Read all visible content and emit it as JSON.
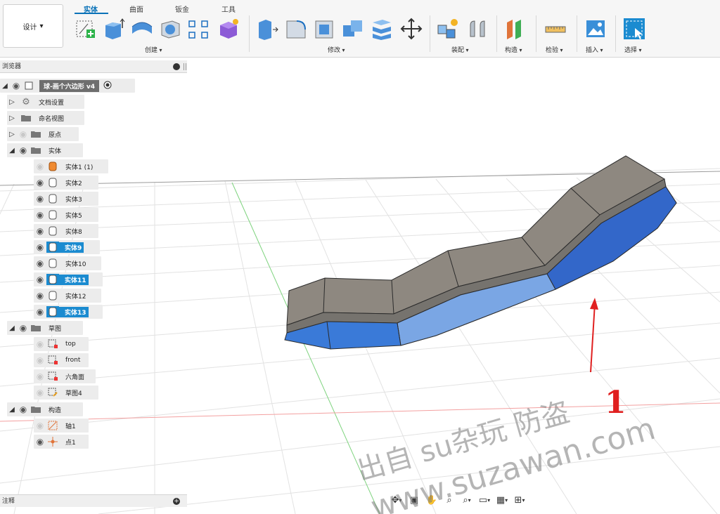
{
  "toolbar": {
    "workspace_label": "设计",
    "tabs": [
      "实体",
      "曲面",
      "钣金",
      "工具"
    ],
    "active_tab": "实体",
    "groups": [
      "创建",
      "修改",
      "装配",
      "构造",
      "检验",
      "插入",
      "选择"
    ]
  },
  "browser": {
    "title": "浏览器",
    "root_label": "球-画个六边形 v4",
    "items": [
      {
        "label": "文档设置"
      },
      {
        "label": "命名视图"
      },
      {
        "label": "原点"
      },
      {
        "label": "实体"
      },
      {
        "label": "实体1 (1)"
      },
      {
        "label": "实体2"
      },
      {
        "label": "实体3"
      },
      {
        "label": "实体5"
      },
      {
        "label": "实体8"
      },
      {
        "label": "实体9"
      },
      {
        "label": "实体10"
      },
      {
        "label": "实体11"
      },
      {
        "label": "实体12"
      },
      {
        "label": "实体13"
      },
      {
        "label": "草图"
      },
      {
        "label": "top"
      },
      {
        "label": "front"
      },
      {
        "label": "六角面"
      },
      {
        "label": "草图4"
      },
      {
        "label": "构造"
      },
      {
        "label": "轴1"
      },
      {
        "label": "点1"
      }
    ]
  },
  "notes_panel": {
    "title": "注释"
  },
  "colors": {
    "accent": "#0a72b8",
    "selected": "#1b8bd0",
    "solid_top": "#8e8880",
    "solid_blue": "#3a7ad8",
    "annotation": "#e02020"
  },
  "watermark": {
    "line1": "出自 su杂玩 防盗",
    "line2": "www.suzawan.com"
  },
  "annotation": {
    "number": "1"
  }
}
